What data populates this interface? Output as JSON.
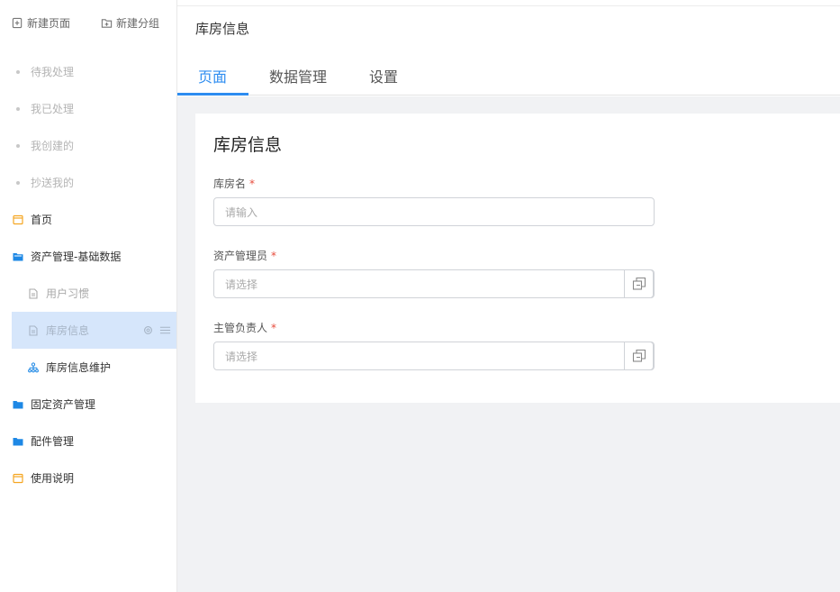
{
  "sidebar": {
    "actions": [
      {
        "label": "新建页面",
        "icon": "new-page-icon"
      },
      {
        "label": "新建分组",
        "icon": "new-group-icon"
      }
    ],
    "items": [
      {
        "label": "待我处理",
        "icon": "dot-icon"
      },
      {
        "label": "我已处理",
        "icon": "dot-icon"
      },
      {
        "label": "我创建的",
        "icon": "dot-icon"
      },
      {
        "label": "抄送我的",
        "icon": "dot-icon"
      },
      {
        "label": "首页",
        "icon": "page-icon"
      },
      {
        "label": "资产管理-基础数据",
        "icon": "folder-open-icon"
      },
      {
        "label": "用户习惯",
        "icon": "document-icon"
      },
      {
        "label": "库房信息",
        "icon": "document-icon"
      },
      {
        "label": "库房信息维护",
        "icon": "org-chart-icon"
      },
      {
        "label": "固定资产管理",
        "icon": "folder-icon"
      },
      {
        "label": "配件管理",
        "icon": "folder-icon"
      },
      {
        "label": "使用说明",
        "icon": "page-icon"
      }
    ]
  },
  "header": {
    "title": "库房信息",
    "tabs": [
      {
        "label": "页面"
      },
      {
        "label": "数据管理"
      },
      {
        "label": "设置"
      }
    ]
  },
  "form": {
    "title": "库房信息",
    "fields": [
      {
        "label": "库房名",
        "required": "*",
        "placeholder": "请输入"
      },
      {
        "label": "资产管理员",
        "required": "*",
        "placeholder": "请选择"
      },
      {
        "label": "主管负责人",
        "required": "*",
        "placeholder": "请选择"
      }
    ]
  },
  "colors": {
    "accent": "#2d8cf0",
    "active_bg": "#d6e6fb",
    "folder": "#1e88e5",
    "page_icon": "#f5a623",
    "required": "#e74c3c"
  }
}
